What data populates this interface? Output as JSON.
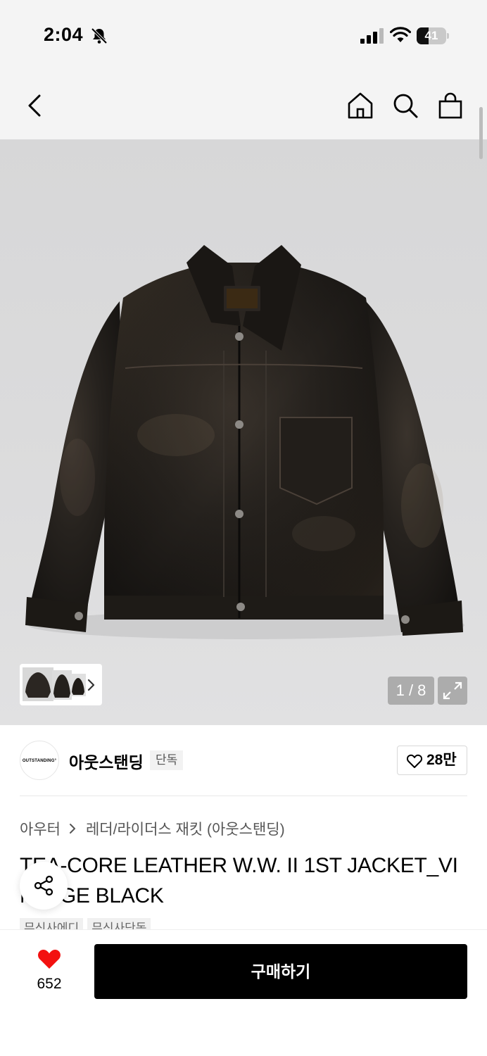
{
  "status_bar": {
    "time": "2:04",
    "battery": "41",
    "battery_level": 0.41
  },
  "nav": {
    "icons": [
      "back-icon",
      "home-icon",
      "search-icon",
      "bag-icon"
    ]
  },
  "gallery": {
    "page_counter": "1 / 8",
    "current_page": 1,
    "total_pages": 8
  },
  "brand": {
    "logo_text": "OUTSTANDING°",
    "name": "아웃스탠딩",
    "tag": "단독",
    "likes": "28만"
  },
  "breadcrumb": {
    "parent": "아우터",
    "child": "레더/라이더스 재킷 (아웃스탠딩)"
  },
  "product": {
    "title": "TEA-CORE LEATHER W.W. II 1ST JACKET_VINTAGE BLACK",
    "title_line1": "TEA-CORE LEATHER W.W. II 1ST JACKET_VI",
    "title_line2": "NTAGE BLACK",
    "chips": [
      "무신사에디",
      "무신사단독"
    ]
  },
  "bottom_bar": {
    "wish_count": "652",
    "buy_label": "구매하기"
  },
  "colors": {
    "accent_red": "#f31110",
    "buy_button": "#000000",
    "nav_bg": "#f4f4f4",
    "hero_bg": "#d9d9da"
  }
}
